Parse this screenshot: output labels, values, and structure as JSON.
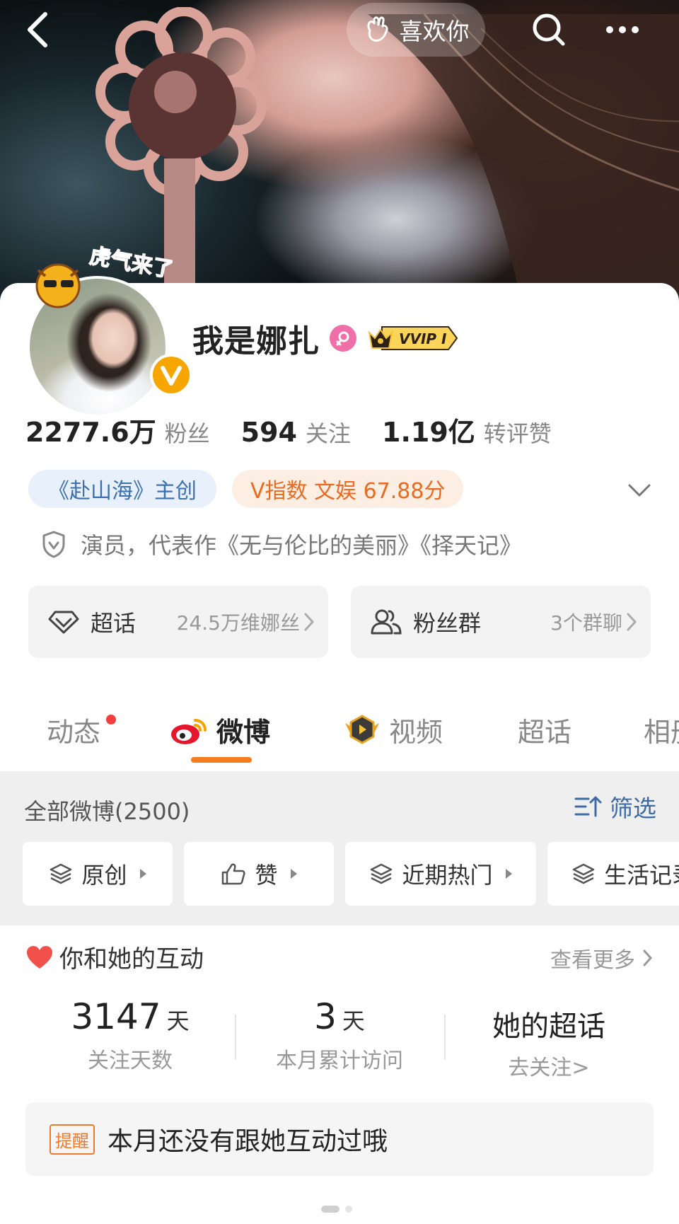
{
  "topbar": {
    "like_label": "喜欢你"
  },
  "profile": {
    "avatar_sticker": "虎气来了",
    "name": "我是娜扎",
    "vip_label": "VVIP I",
    "stats": [
      {
        "value": "2277.6万",
        "label": "粉丝"
      },
      {
        "value": "594",
        "label": "关注"
      },
      {
        "value": "1.19亿",
        "label": "转评赞"
      }
    ],
    "tag_work": "《赴山海》主创",
    "tag_index": "V指数 文娱 67.88分",
    "bio": "演员，代表作《无与伦比的美丽》《择天记》",
    "supertopic": {
      "title": "超话",
      "sub": "24.5万维娜丝"
    },
    "fangroup": {
      "title": "粉丝群",
      "sub": "3个群聊"
    }
  },
  "tabs": [
    {
      "label": "动态",
      "dot": true
    },
    {
      "label": "微博",
      "active": true
    },
    {
      "label": "视频"
    },
    {
      "label": "超话"
    },
    {
      "label": "相册"
    }
  ],
  "feed": {
    "title": "全部微博(2500)",
    "filter_label": "筛选",
    "chips": [
      "原创",
      "赞",
      "近期热门",
      "生活记录"
    ]
  },
  "interaction": {
    "title": "你和她的互动",
    "see_more": "查看更多",
    "follow_days": {
      "value": "3147",
      "unit": "天",
      "caption": "关注天数"
    },
    "visits": {
      "value": "3",
      "unit": "天",
      "caption": "本月累计访问"
    },
    "supertopic": {
      "value": "她的超话",
      "caption": "去关注>"
    },
    "reminder_tag": "提醒",
    "reminder_text": "本月还没有跟她互动过哦"
  },
  "colors": {
    "accent_orange": "#f57c1f",
    "link_blue": "#3d6ba8",
    "tag_blue_bg": "#e8f0fb",
    "tag_orange_bg": "#fdeee4",
    "notification_red": "#f33e3e"
  }
}
